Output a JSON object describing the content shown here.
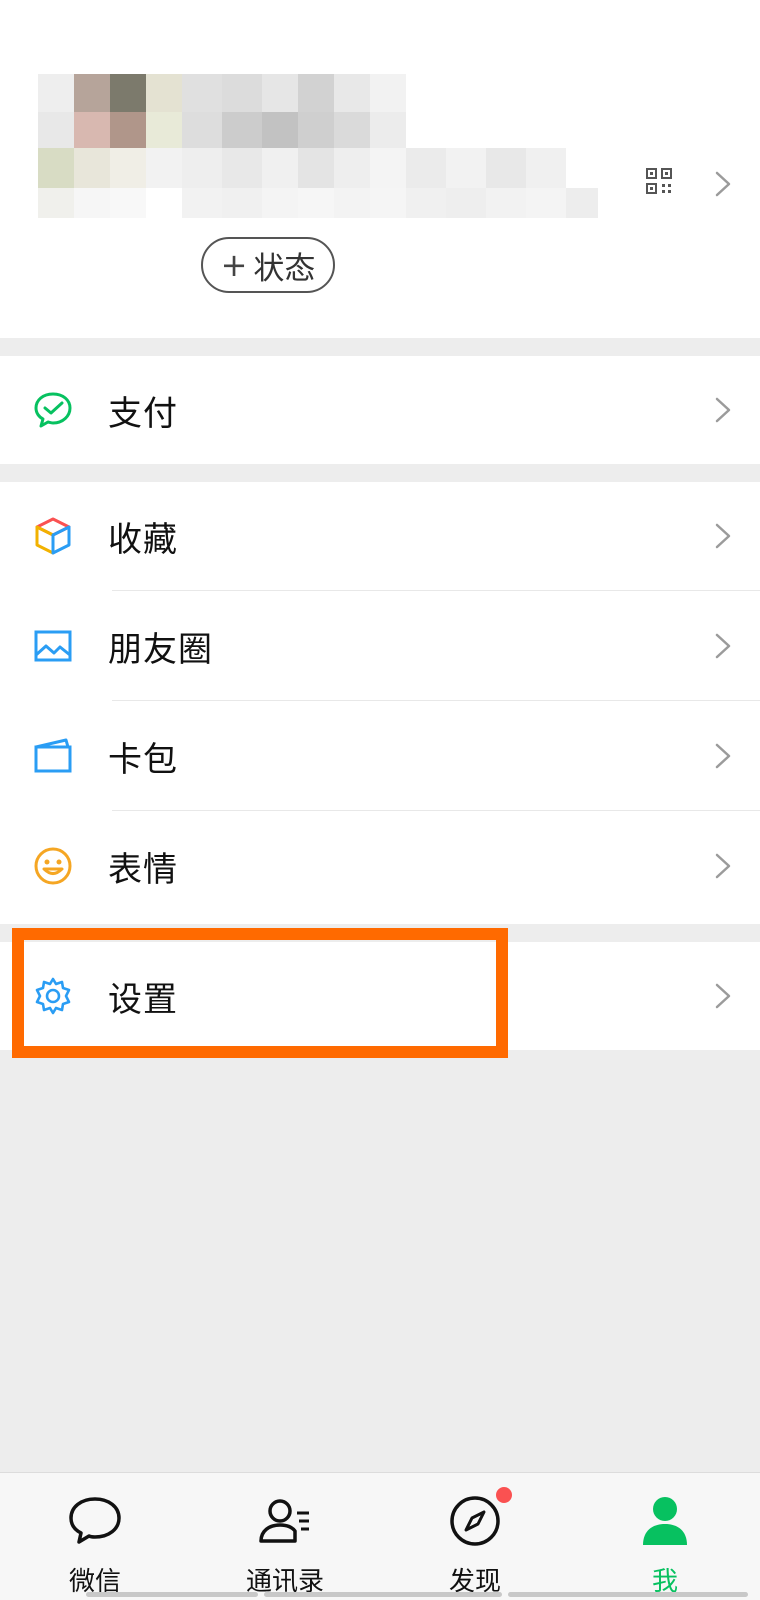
{
  "profile": {
    "status_button": "状态",
    "status_plus": "+"
  },
  "menu": {
    "pay": "支付",
    "favorites": "收藏",
    "moments": "朋友圈",
    "cards": "卡包",
    "stickers": "表情",
    "settings": "设置"
  },
  "tabs": [
    {
      "label": "微信",
      "icon": "chat-bubble-icon"
    },
    {
      "label": "通讯录",
      "icon": "contacts-icon"
    },
    {
      "label": "发现",
      "icon": "compass-icon"
    },
    {
      "label": "我",
      "icon": "person-icon"
    }
  ],
  "colors": {
    "accent_green": "#07c160",
    "highlight_orange": "#ff6a00",
    "badge_red": "#fa5151"
  }
}
